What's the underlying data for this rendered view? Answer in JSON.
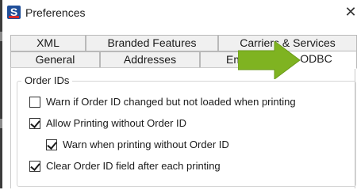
{
  "window": {
    "title": "Preferences",
    "close_glyph": "✕",
    "app_icon": "s-logo-icon"
  },
  "tabs": {
    "row1": [
      {
        "label": "XML"
      },
      {
        "label": "Branded Features"
      },
      {
        "label": "Carriers & Services"
      }
    ],
    "row2": [
      {
        "label": "General"
      },
      {
        "label": "Addresses"
      },
      {
        "label": "Em"
      },
      {
        "label": "ODBC",
        "active": true
      }
    ]
  },
  "group": {
    "title": "Order IDs",
    "options": [
      {
        "label": "Warn if Order ID changed but not loaded when printing",
        "checked": false
      },
      {
        "label": "Allow Printing without Order ID",
        "checked": true
      },
      {
        "label": "Warn when printing without Order ID",
        "checked": true
      },
      {
        "label": "Clear Order ID field after each printing",
        "checked": true
      }
    ]
  },
  "annotation": {
    "icon": "green-arrow-icon",
    "color": "#7fb321"
  }
}
